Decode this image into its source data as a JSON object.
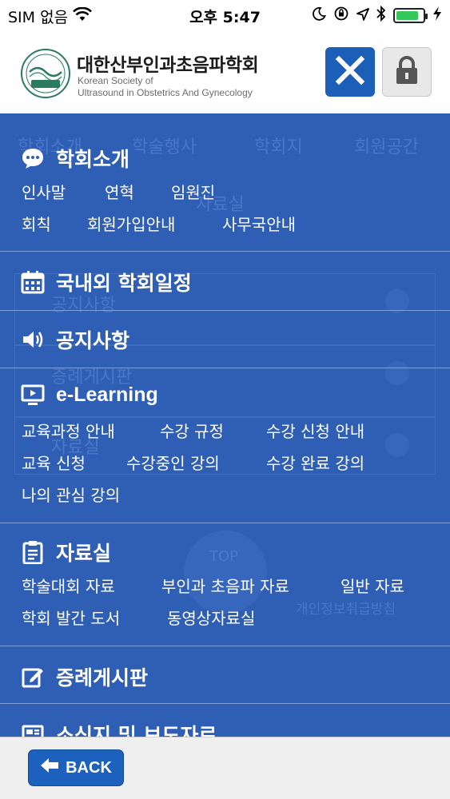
{
  "status_bar": {
    "carrier": "SIM 없음",
    "time": "오후 5:47",
    "battery_level": 0.85
  },
  "header": {
    "title_ko": "대한산부인과초음파학회",
    "title_en_line1": "Korean Society of",
    "title_en_line2": "Ultrasound in Obstetrics And Gynecology",
    "logo_text": "KSUOG"
  },
  "background_ghost": {
    "nav_items": [
      "학회소개",
      "학술행사",
      "학회지",
      "회원공간"
    ],
    "section_title": "자료실",
    "list_items": [
      "공지사항",
      "증례게시판",
      "자료실"
    ],
    "top_button": "TOP",
    "footer_fragment": "개인정보취급방침"
  },
  "menu": {
    "sections": [
      {
        "title": "학회소개",
        "icon": "chat-bubble-icon",
        "items": [
          "인사말",
          "연혁",
          "임원진",
          "회칙",
          "회원가입안내",
          "사무국안내"
        ]
      },
      {
        "title": "국내외 학회일정",
        "icon": "calendar-icon",
        "items": []
      },
      {
        "title": "공지사항",
        "icon": "speaker-icon",
        "items": []
      },
      {
        "title": "e-Learning",
        "icon": "monitor-play-icon",
        "items": [
          "교육과정 안내",
          "수강 규정",
          "수강 신청 안내",
          "교육 신청",
          "수강중인 강의",
          "수강 완료 강의",
          "나의 관심 강의"
        ]
      },
      {
        "title": "자료실",
        "icon": "clipboard-icon",
        "items": [
          "학술대회 자료",
          "부인과 초음파 자료",
          "일반 자료",
          "학회 발간 도서",
          "동영상자료실"
        ]
      },
      {
        "title": "증례게시판",
        "icon": "edit-icon",
        "items": []
      },
      {
        "title": "소식지 및 보도자료",
        "icon": "newspaper-icon",
        "items": []
      }
    ]
  },
  "bottom": {
    "back_label": "BACK"
  },
  "colors": {
    "menu_bg": "#2f5eb5",
    "accent": "#1c5fb8",
    "battery": "#35c759"
  }
}
